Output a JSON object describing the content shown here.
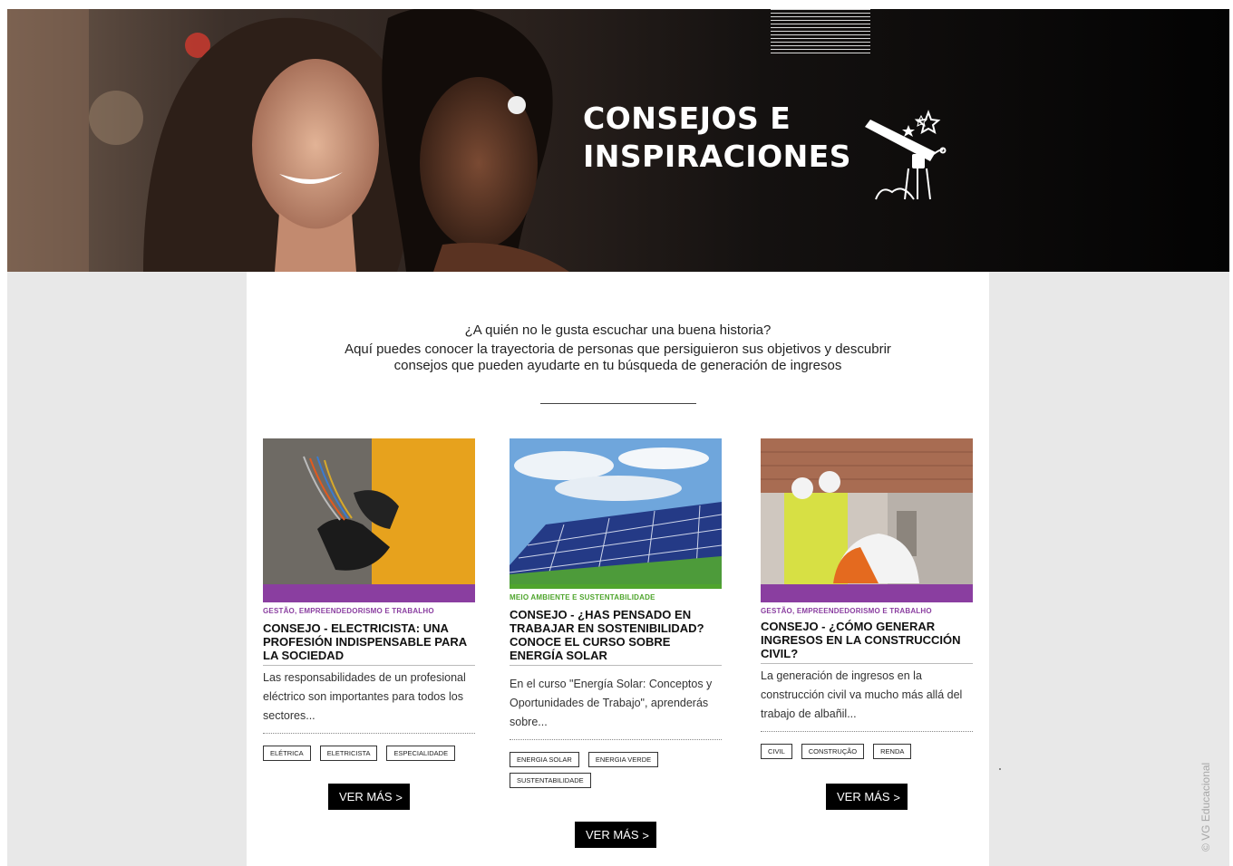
{
  "hero": {
    "title": "CONSEJOS E\nINSPIRACIONES",
    "icon": "telescope-icon"
  },
  "intro": {
    "question": "¿A quién no le gusta escuchar una buena historia?",
    "text": "Aquí puedes conocer la trayectoria de personas que persiguieron sus objetivos y descubrir consejos que pueden ayudarte en tu búsqueda de generación de ingresos"
  },
  "cards": [
    {
      "category": "GESTÃO, EMPREENDEDORISMO E TRABALHO",
      "category_color": "#8a3ea0",
      "title": "CONSEJO - ELECTRICISTA: UNA PROFESIÓN INDISPENSABLE PARA LA SOCIEDAD",
      "description": "Las responsabilidades de un profesional eléctrico son importantes para todos los sectores...",
      "tags": [
        "ELÉTRICA",
        "ELETRICISTA",
        "ESPECIALIDADE"
      ],
      "button": "VER MÁS",
      "button_icon": "chevron-right-icon"
    },
    {
      "category": "MEIO AMBIENTE E SUSTENTABILIDADE",
      "category_color": "#4fa52d",
      "title": "CONSEJO - ¿HAS PENSADO EN TRABAJAR EN SOSTENIBILIDAD? CONOCE EL CURSO SOBRE ENERGÍA SOLAR",
      "description": "En el curso \"Energía Solar: Conceptos y Oportunidades de Trabajo\", aprenderás sobre...",
      "tags": [
        "ENERGIA SOLAR",
        "ENERGIA VERDE",
        "SUSTENTABILIDADE"
      ],
      "button": "VER MÁS",
      "button_icon": "chevron-right-icon"
    },
    {
      "category": "GESTÃO, EMPREENDEDORISMO E TRABALHO",
      "category_color": "#8a3ea0",
      "title": "CONSEJO - ¿CÓMO GENERAR INGRESOS EN LA CONSTRUCCIÓN CIVIL?",
      "description": "La generación de ingresos en la construcción civil va mucho más allá del trabajo de albañil...",
      "tags": [
        "CIVIL",
        "CONSTRUÇÃO",
        "RENDA"
      ],
      "button": "VER MÁS",
      "button_icon": "chevron-right-icon"
    }
  ],
  "credit": "© VG Educacional"
}
